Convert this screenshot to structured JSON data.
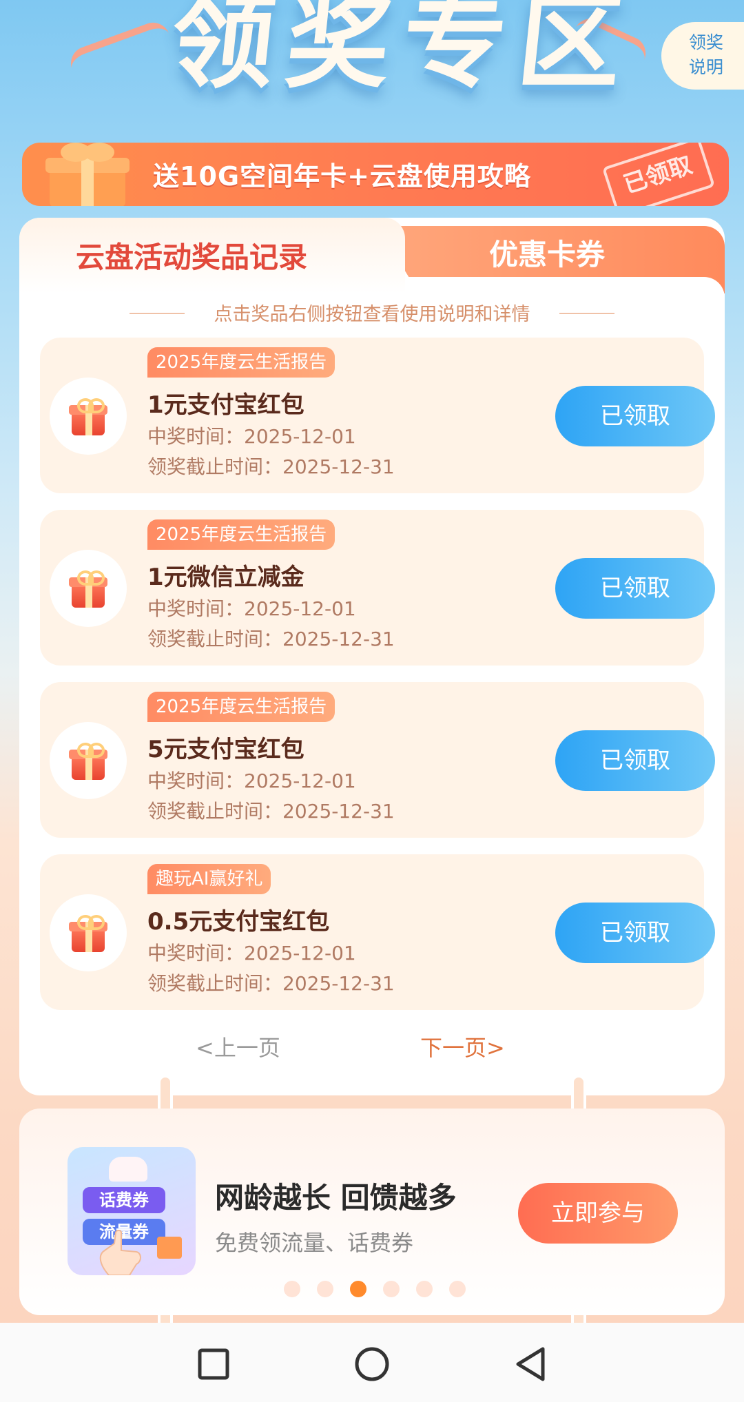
{
  "header": {
    "title": "领奖专区",
    "rules_label": "领奖\n说明"
  },
  "banner": {
    "text": "送10G空间年卡+云盘使用攻略",
    "status": "已领取"
  },
  "tabs": [
    {
      "label": "云盘活动奖品记录",
      "active": true
    },
    {
      "label": "优惠卡券",
      "active": false
    }
  ],
  "hint": "点击奖品右侧按钮查看使用说明和详情",
  "prizes": [
    {
      "tag": "2025年度云生活报告",
      "name": "1元支付宝红包",
      "time": "中奖时间：2025-12-01",
      "deadline": "领奖截止时间：2025-12-31",
      "button": "已领取"
    },
    {
      "tag": "2025年度云生活报告",
      "name": "1元微信立减金",
      "time": "中奖时间：2025-12-01",
      "deadline": "领奖截止时间：2025-12-31",
      "button": "已领取"
    },
    {
      "tag": "2025年度云生活报告",
      "name": "5元支付宝红包",
      "time": "中奖时间：2025-12-01",
      "deadline": "领奖截止时间：2025-12-31",
      "button": "已领取"
    },
    {
      "tag": "趣玩AI赢好礼",
      "name": "0.5元支付宝红包",
      "time": "中奖时间：2025-12-01",
      "deadline": "领奖截止时间：2025-12-31",
      "button": "已领取"
    }
  ],
  "pager": {
    "prev": "<上一页",
    "next": "下一页>"
  },
  "promo": {
    "image_tags": [
      "话费券",
      "流量券"
    ],
    "title": "网龄越长 回馈越多",
    "subtitle": "免费领流量、话费券",
    "button": "立即参与",
    "carousel_count": 6,
    "carousel_active": 3
  },
  "colors": {
    "accent_blue": "#2ea4f5",
    "accent_orange": "#ff8a5c",
    "title_red": "#e2493b"
  }
}
